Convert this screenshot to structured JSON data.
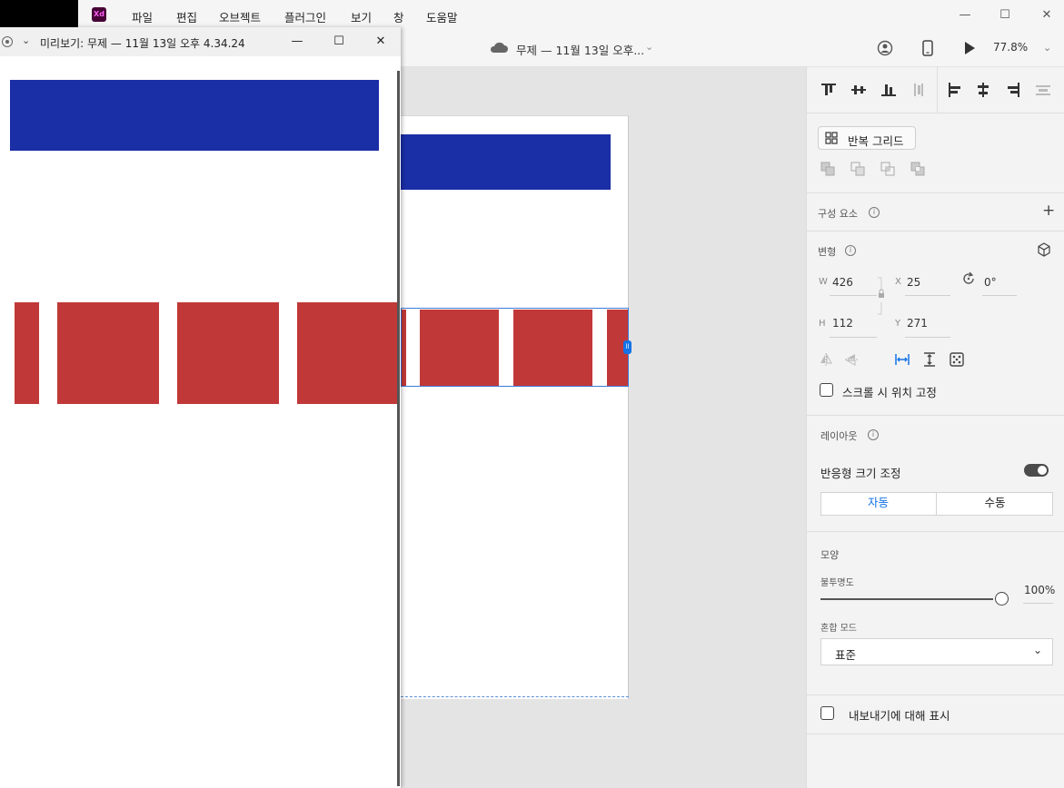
{
  "app": {
    "logo_text": "Xd"
  },
  "menubar": {
    "items": [
      "파일",
      "편집",
      "오브젝트",
      "플러그인",
      "보기",
      "창",
      "도움말"
    ]
  },
  "window_controls": {
    "minimize": "—",
    "maximize": "☐",
    "close": "✕"
  },
  "toolbar": {
    "doc_title": "무제 — 11월 13일 오후...",
    "zoom": "77.8%"
  },
  "preview": {
    "title": "미리보기: 무제 — 11월 13일 오후 4.34.24"
  },
  "colors": {
    "blue": "#1a2ea5",
    "red": "#c13838",
    "accent": "#1473e6"
  },
  "panel": {
    "repeat_grid": "반복 그리드",
    "components": {
      "label": "구성 요소",
      "add": "+"
    },
    "transform": {
      "label": "변형",
      "w_label": "W",
      "w": "426",
      "x_label": "X",
      "x": "25",
      "rotation": "0°",
      "h_label": "H",
      "h": "112",
      "y_label": "Y",
      "y": "271",
      "fix_on_scroll": "스크롤 시 위치 고정"
    },
    "layout": {
      "label": "레이아웃",
      "responsive_resize": "반응형 크기 조정",
      "auto": "자동",
      "manual": "수동"
    },
    "appearance": {
      "label": "모양",
      "opacity_label": "불투명도",
      "opacity": "100%",
      "blend_label": "혼합 모드",
      "blend_value": "표준"
    },
    "export": {
      "mark_for_export": "내보내기에 대해 표시"
    }
  }
}
